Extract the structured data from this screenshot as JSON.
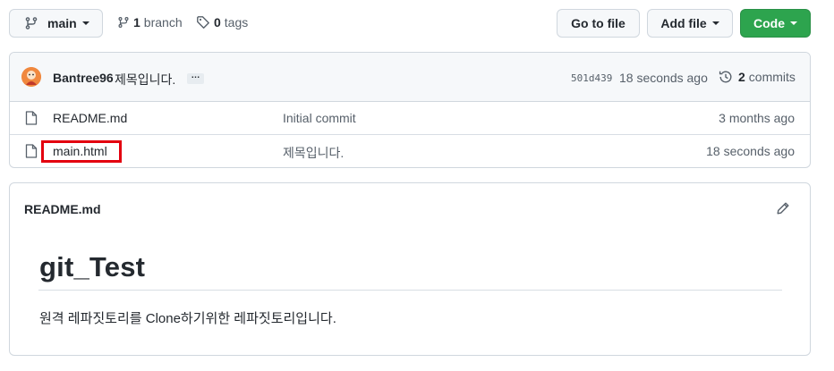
{
  "toolbar": {
    "branch_name": "main",
    "branch_count": "1",
    "branch_label": "branch",
    "tag_count": "0",
    "tag_label": "tags",
    "goto_file_label": "Go to file",
    "add_file_label": "Add file",
    "code_label": "Code"
  },
  "latest_commit": {
    "author": "Bantree96",
    "message": "제목입니다.",
    "ellipsis": "…",
    "sha": "501d439",
    "age": "18 seconds ago",
    "commit_count": "2",
    "commit_label": "commits"
  },
  "files": [
    {
      "name": "README.md",
      "commit_message": "Initial commit",
      "age": "3 months ago"
    },
    {
      "name": "main.html",
      "commit_message": "제목입니다.",
      "age": "18 seconds ago"
    }
  ],
  "readme": {
    "filename": "README.md",
    "heading": "git_Test",
    "body": "원격 레파짓토리를 Clone하기위한 레파짓토리입니다."
  },
  "colors": {
    "primary_green": "#2da44e",
    "highlight_red": "#e3000f",
    "border": "#d0d7de"
  }
}
